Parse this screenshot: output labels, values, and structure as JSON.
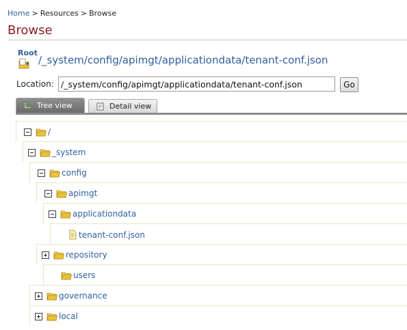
{
  "breadcrumb": {
    "home": "Home",
    "sep1": ">",
    "resources": "Resources",
    "sep2": ">",
    "current": "Browse"
  },
  "page_title": "Browse",
  "root_label": "Root",
  "resource_path": "/_system/config/apimgt/applicationdata/tenant-conf.json",
  "location": {
    "label": "Location:",
    "value": "/_system/config/apimgt/applicationdata/tenant-conf.json",
    "go_label": "Go"
  },
  "tabs": [
    {
      "label": "Tree view",
      "active": true,
      "icon": "tree-view-icon"
    },
    {
      "label": "Detail view",
      "active": false,
      "icon": "detail-view-icon"
    }
  ],
  "tree": [
    {
      "label": "/",
      "type": "folder",
      "expander": "minus"
    },
    {
      "label": "_system",
      "type": "folder",
      "expander": "minus"
    },
    {
      "label": "config",
      "type": "folder",
      "expander": "minus"
    },
    {
      "label": "apimgt",
      "type": "folder",
      "expander": "minus"
    },
    {
      "label": "applicationdata",
      "type": "folder",
      "expander": "minus"
    },
    {
      "label": "tenant-conf.json",
      "type": "file",
      "expander": "none"
    },
    {
      "label": "repository",
      "type": "folder",
      "expander": "plus"
    },
    {
      "label": "users",
      "type": "folder",
      "expander": "none"
    },
    {
      "label": "governance",
      "type": "folder",
      "expander": "plus"
    },
    {
      "label": "local",
      "type": "folder",
      "expander": "plus"
    }
  ],
  "colors": {
    "link": "#2f5f9e",
    "title": "#8e1d1d",
    "folder": "#e8c23a"
  }
}
